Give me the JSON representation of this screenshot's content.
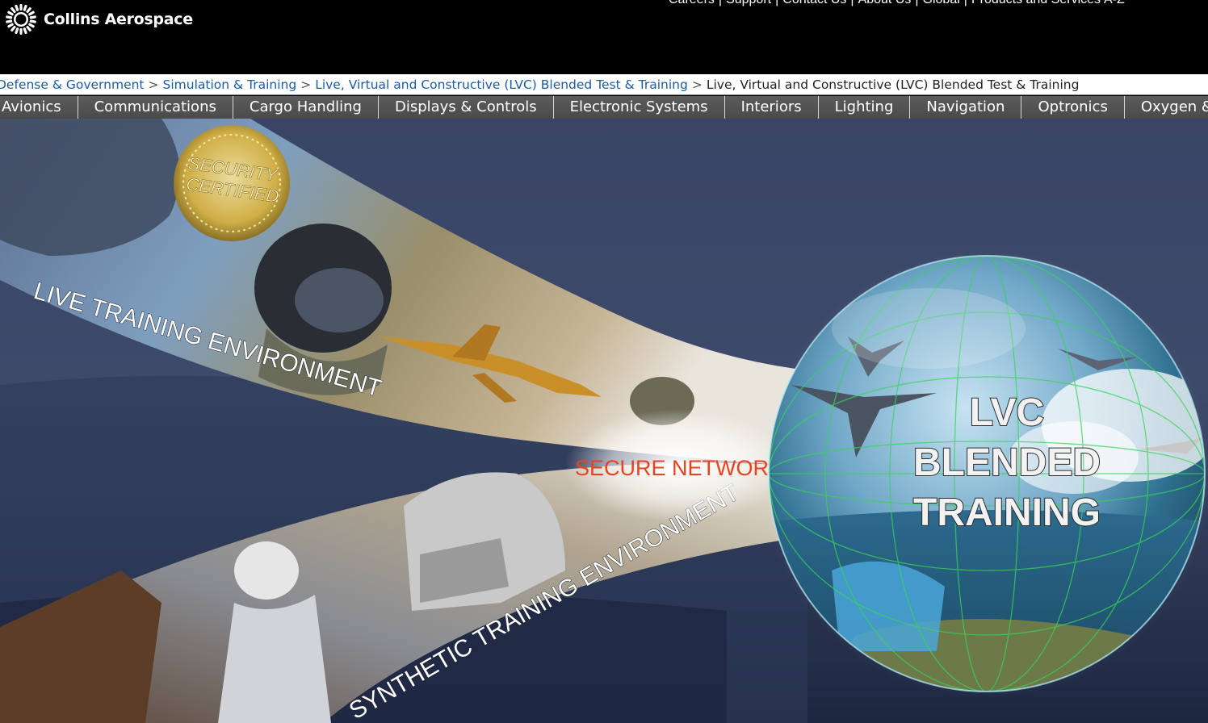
{
  "brand": {
    "name": "Collins Aerospace"
  },
  "utility_nav": {
    "links": [
      "Careers",
      "Support",
      "Contact Us",
      "About Us",
      "Global",
      "Products and Services"
    ],
    "az": "A-Z"
  },
  "breadcrumb": {
    "items": [
      "Defense & Government",
      "Simulation & Training",
      "Live, Virtual and Constructive (LVC) Blended Test & Training"
    ],
    "current": "Live, Virtual and Constructive (LVC) Blended Test & Training"
  },
  "main_nav": {
    "items": [
      "Avionics",
      "Communications",
      "Cargo Handling",
      "Displays & Controls",
      "Electronic Systems",
      "Interiors",
      "Lighting",
      "Navigation",
      "Optronics",
      "Oxygen & PSU"
    ]
  },
  "hero": {
    "badge_line1": "SECURITY",
    "badge_line2": "CERTIFIED",
    "live_label": "LIVE TRAINING ENVIRONMENT",
    "synthetic_label": "SYNTHETIC TRAINING ENVIRONMENT",
    "network_label": "SECURE NETWORK",
    "globe_line1": "LVC",
    "globe_line2": "BLENDED",
    "globe_line3": "TRAINING"
  },
  "colors": {
    "header_bg": "#000000",
    "link_blue": "#1a5ca6",
    "nav_bg": "#545454",
    "breadcrumb_rule": "#d66d40",
    "network_text": "#e8421f",
    "badge_gold": "#d9b13a",
    "globe_green": "#38d35a"
  },
  "icons": [
    "collins-logo-icon"
  ]
}
